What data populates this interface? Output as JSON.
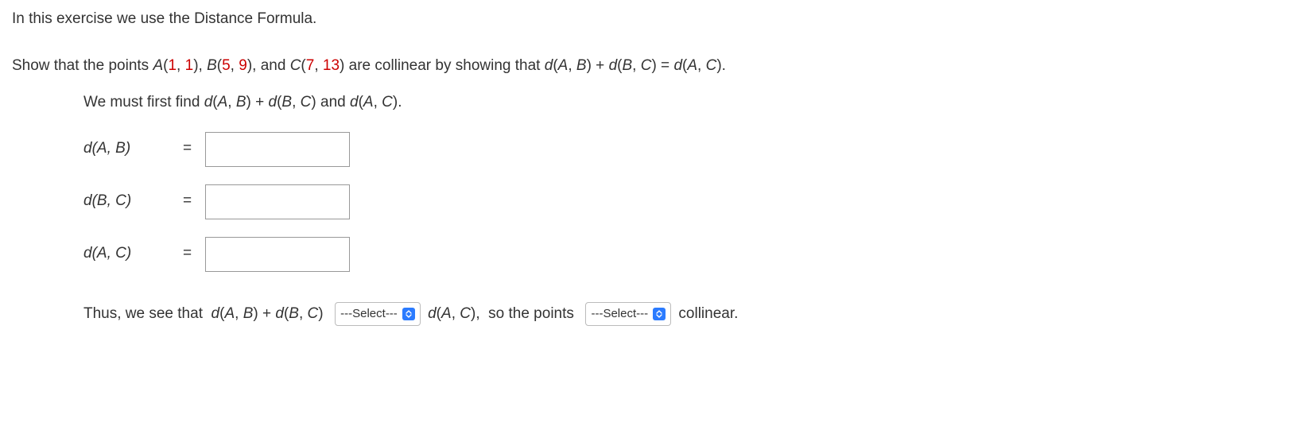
{
  "intro": "In this exercise we use the Distance Formula.",
  "problem": {
    "prefix": "Show that the points  ",
    "A_label": "A",
    "A_open": "(",
    "A_x": "1",
    "A_comma": ", ",
    "A_y": "1",
    "A_close": "), ",
    "B_label": "B",
    "B_open": "(",
    "B_x": "5",
    "B_comma": ", ",
    "B_y": "9",
    "B_close": "), and ",
    "C_label": "C",
    "C_open": "(",
    "C_x": "7",
    "C_comma": ", ",
    "C_y": "13",
    "C_close": ")",
    "mid": "  are collinear by showing that  ",
    "dAB": "d",
    "dAB_args": "(A, B)",
    "plus": " + ",
    "dBC": "d",
    "dBC_args": "(B, C)",
    "eq": " = ",
    "dAC": "d",
    "dAC_args": "(A, C)",
    "end": "."
  },
  "instruct": {
    "prefix": "We must first find  ",
    "dAB": "d",
    "dAB_args": "(A, B)",
    "plus": " + ",
    "dBC": "d",
    "dBC_args": "(B, C)",
    "and": " and ",
    "dAC": "d",
    "dAC_args": "(A, C)",
    "end": "."
  },
  "rows": [
    {
      "d": "d",
      "args": "(A, B)",
      "eq": "=",
      "value": ""
    },
    {
      "d": "d",
      "args": "(B, C)",
      "eq": "=",
      "value": ""
    },
    {
      "d": "d",
      "args": "(A, C)",
      "eq": "=",
      "value": ""
    }
  ],
  "conclusion": {
    "t1": "Thus, we see that  ",
    "dAB": "d",
    "dAB_args": "(A, B)",
    "plus": " + ",
    "dBC": "d",
    "dBC_args": "(B, C)",
    "gap1": "  ",
    "select1": "---Select---",
    "gap2": " ",
    "dAC": "d",
    "dAC_args": "(A, C)",
    "t2": ",  so the points  ",
    "select2": "---Select---",
    "t3": " collinear."
  }
}
